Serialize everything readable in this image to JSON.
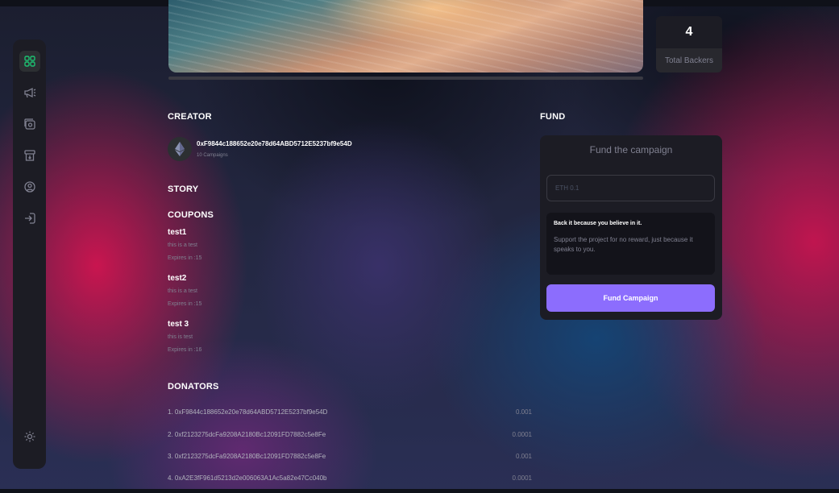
{
  "stats": {
    "backers_value": "4",
    "backers_label": "Total Backers"
  },
  "creator": {
    "title": "CREATOR",
    "address": "0xF9844c188652e20e78d64ABD5712E5237bf9e54D",
    "campaigns": "10 Campaigns"
  },
  "story": {
    "title": "STORY"
  },
  "coupons": {
    "title": "COUPONS",
    "items": [
      {
        "name": "test1",
        "desc": "this is a test",
        "expires": "Expires in :15"
      },
      {
        "name": "test2",
        "desc": "this is a test",
        "expires": "Expires in :15"
      },
      {
        "name": "test 3",
        "desc": "this is test",
        "expires": "Expires in :16"
      }
    ]
  },
  "donators": {
    "title": "DONATORS",
    "rows": [
      {
        "label": "1. 0xF9844c188652e20e78d64ABD5712E5237bf9e54D",
        "amount": "0.001"
      },
      {
        "label": "2. 0xf2123275dcFa9208A2180Bc12091FD7882c5e8Fe",
        "amount": "0.0001"
      },
      {
        "label": "3. 0xf2123275dcFa9208A2180Bc12091FD7882c5e8Fe",
        "amount": "0.001"
      },
      {
        "label": "4. 0xA2E3fF961d5213d2e006063A1Ac5a82e47Cc040b",
        "amount": "0.0001"
      }
    ]
  },
  "fund": {
    "title": "FUND",
    "box_title": "Fund the campaign",
    "input_placeholder": "ETH 0.1",
    "info_heading": "Back it because you believe in it.",
    "info_text": "Support the project for no reward, just because it speaks to you.",
    "button_label": "Fund Campaign"
  },
  "sidebar": {
    "icons": [
      "dashboard-icon",
      "campaign-icon",
      "payment-icon",
      "withdraw-icon",
      "profile-icon",
      "logout-icon",
      "sun-icon"
    ]
  },
  "colors": {
    "accent": "#8c6dfd",
    "active_icon": "#1dc071",
    "panel": "#1c1c24"
  }
}
